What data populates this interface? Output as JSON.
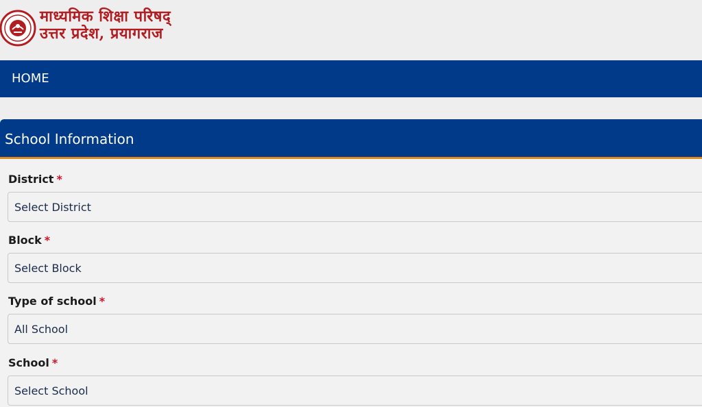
{
  "header": {
    "brand_line1": "माध्यमिक शिक्षा परिषद्",
    "brand_line2": "उत्तर प्रदेश, प्रयागराज",
    "logo_icon": "up-govt-emblem-icon",
    "brand_color": "#b21d22"
  },
  "nav": {
    "home_label": "HOME",
    "bar_color": "#003a88"
  },
  "card": {
    "title": "School Information",
    "accent_color": "#e08a1e"
  },
  "form": {
    "required_mark": "*",
    "fields": [
      {
        "label": "District",
        "value": "Select District"
      },
      {
        "label": "Block",
        "value": "Select Block"
      },
      {
        "label": "Type of school",
        "value": "All School"
      },
      {
        "label": "School",
        "value": "Select School"
      }
    ]
  }
}
